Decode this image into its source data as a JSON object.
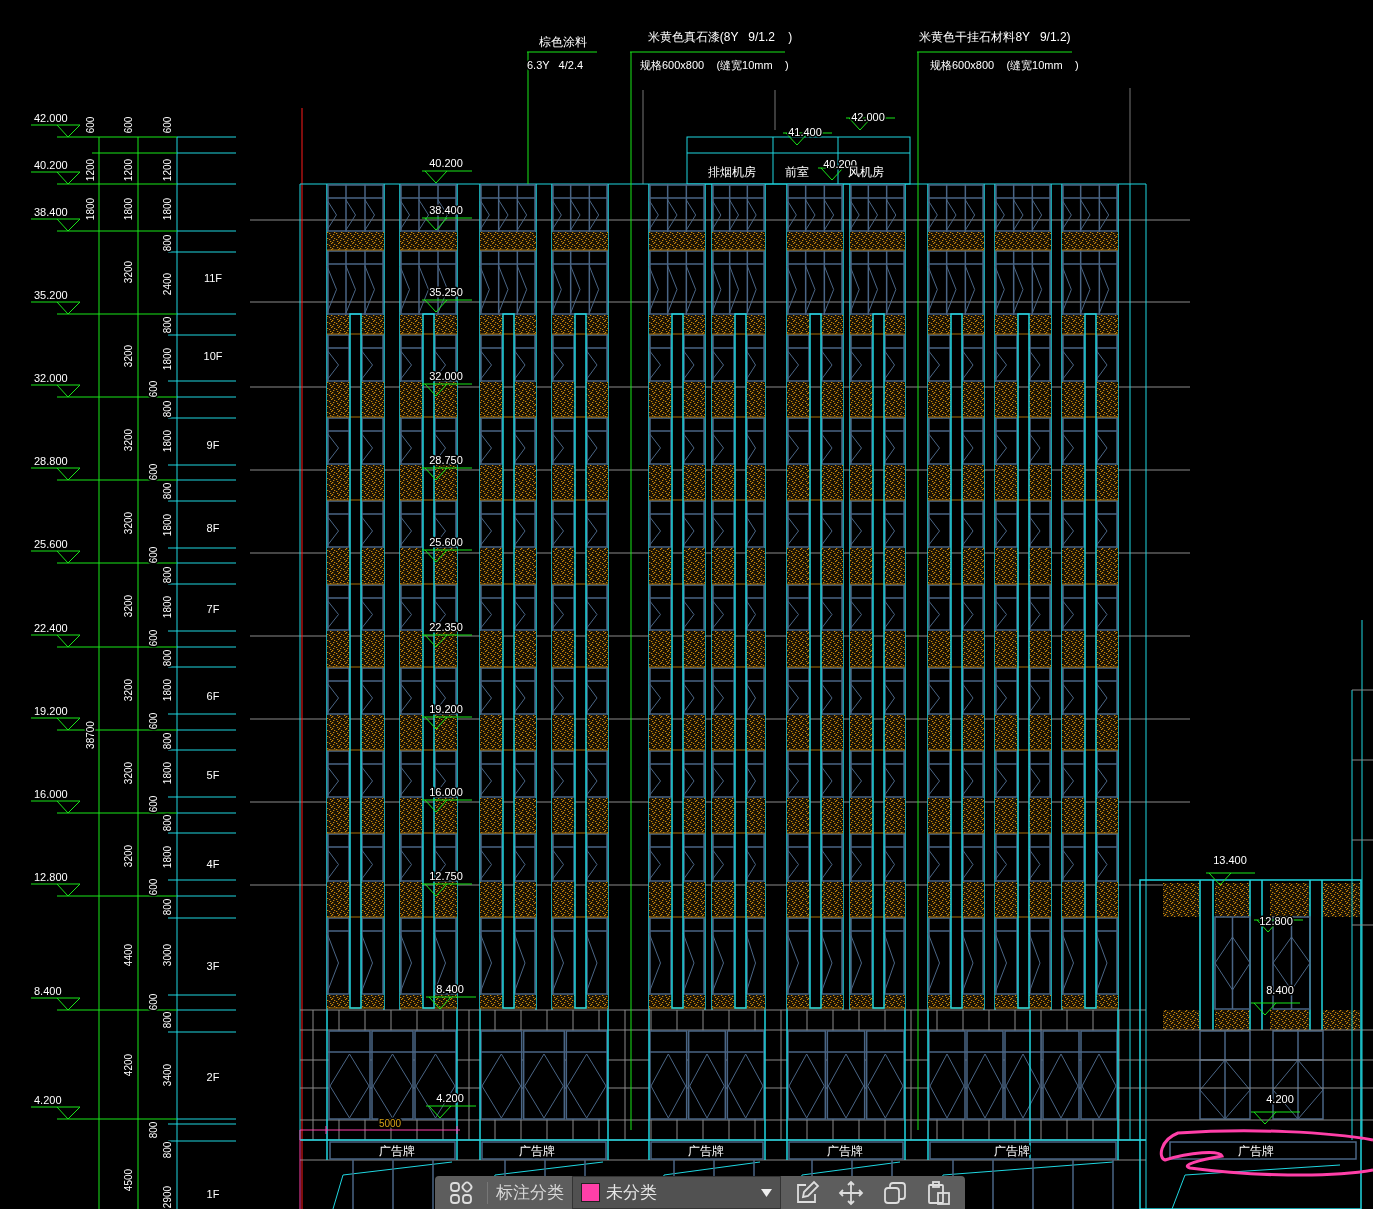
{
  "callouts": [
    {
      "title": "棕色涂料",
      "spec": "6.3Y   4/2.4"
    },
    {
      "title": "米黄色真石漆(8Y   9/1.2    )",
      "spec": "规格600x800    (缝宽10mm    )"
    },
    {
      "title": "米黄色干挂石材料8Y   9/1.2)",
      "spec": "规格600x800    (缝宽10mm    )"
    }
  ],
  "level_marks": [
    "42.000",
    "40.200",
    "38.400",
    "35.200",
    "32.000",
    "28.800",
    "25.600",
    "22.400",
    "19.200",
    "16.000",
    "12.800",
    "8.400",
    "4.200"
  ],
  "dimension_chains": [
    [
      "600",
      "1200",
      "1800",
      "38700"
    ],
    [
      "600",
      "1200",
      "1800",
      "3200",
      "3200",
      "3200",
      "3200",
      "3200",
      "3200",
      "3200",
      "3200",
      "4400",
      "4200",
      "4500"
    ],
    [
      "600",
      "600",
      "600",
      "600",
      "600",
      "600",
      "600",
      "600",
      "800"
    ],
    [
      "600",
      "1200",
      "1800",
      "800",
      "2400",
      "800",
      "1800",
      "800",
      "1800",
      "800",
      "1800",
      "800",
      "1800",
      "800",
      "1800",
      "800",
      "1800",
      "800",
      "1800",
      "800",
      "3000",
      "800",
      "3400",
      "800",
      "2900"
    ]
  ],
  "floors": [
    "11F",
    "10F",
    "9F",
    "8F",
    "7F",
    "6F",
    "5F",
    "4F",
    "3F",
    "2F",
    "1F"
  ],
  "facade_levels": [
    "40.200",
    "38.400",
    "35.250",
    "32.000",
    "28.750",
    "25.600",
    "22.350",
    "19.200",
    "16.000",
    "12.750",
    "8.400",
    "4.200"
  ],
  "roof": {
    "levels": [
      "41.400",
      "42.000",
      "40.200"
    ],
    "rooms": [
      "排烟机房",
      "前室",
      "风机房"
    ]
  },
  "podium_levels": [
    "13.400",
    "12.800",
    "8.400",
    "4.200"
  ],
  "dimension": "5000",
  "signs": [
    "广告牌",
    "广告牌",
    "广告牌",
    "广告牌",
    "广告牌",
    "广告牌"
  ],
  "toolbar": {
    "label": "标注分类",
    "category": {
      "name": "未分类",
      "color": "#ff3fa8"
    }
  }
}
